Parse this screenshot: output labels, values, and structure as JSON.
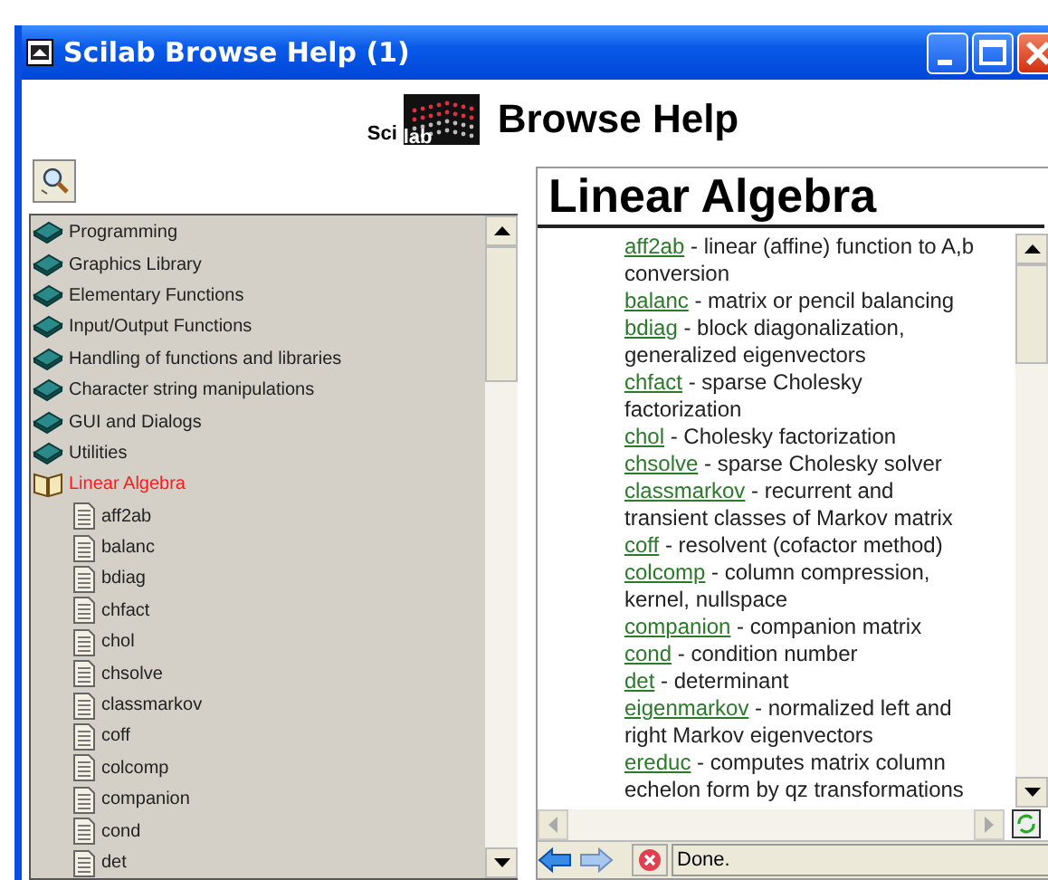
{
  "window": {
    "title": "Scilab Browse Help (1)"
  },
  "header": {
    "logo_text": "Sci",
    "logo_text2": "lab",
    "title": "Browse Help"
  },
  "tree": [
    {
      "label": "Programming",
      "expanded": false,
      "selected": false
    },
    {
      "label": "Graphics Library",
      "expanded": false,
      "selected": false
    },
    {
      "label": "Elementary Functions",
      "expanded": false,
      "selected": false
    },
    {
      "label": "Input/Output Functions",
      "expanded": false,
      "selected": false
    },
    {
      "label": "Handling of functions and libraries",
      "expanded": false,
      "selected": false
    },
    {
      "label": "Character string manipulations",
      "expanded": false,
      "selected": false
    },
    {
      "label": "GUI and Dialogs",
      "expanded": false,
      "selected": false
    },
    {
      "label": "Utilities",
      "expanded": false,
      "selected": false
    },
    {
      "label": "Linear Algebra",
      "expanded": true,
      "selected": true,
      "children": [
        {
          "label": "aff2ab",
          "selected": false
        },
        {
          "label": "balanc",
          "selected": false
        },
        {
          "label": "bdiag",
          "selected": false
        },
        {
          "label": "chfact",
          "selected": false
        },
        {
          "label": "chol",
          "selected": false
        },
        {
          "label": "chsolve",
          "selected": false
        },
        {
          "label": "classmarkov",
          "selected": false
        },
        {
          "label": "coff",
          "selected": false
        },
        {
          "label": "colcomp",
          "selected": false
        },
        {
          "label": "companion",
          "selected": false
        },
        {
          "label": "cond",
          "selected": false
        },
        {
          "label": "det",
          "selected": false
        }
      ]
    }
  ],
  "page": {
    "heading": "Linear Algebra",
    "entries": [
      {
        "name": "aff2ab",
        "description": " - linear (affine) function to A,b conversion"
      },
      {
        "name": "balanc",
        "description": " - matrix or pencil balancing"
      },
      {
        "name": "bdiag",
        "description": " - block diagonalization, generalized eigenvectors"
      },
      {
        "name": "chfact",
        "description": " - sparse Cholesky factorization"
      },
      {
        "name": "chol",
        "description": " - Cholesky factorization"
      },
      {
        "name": "chsolve",
        "description": " - sparse Cholesky solver"
      },
      {
        "name": "classmarkov",
        "description": " - recurrent and transient classes of Markov matrix"
      },
      {
        "name": "coff",
        "description": " - resolvent (cofactor method)"
      },
      {
        "name": "colcomp",
        "description": " - column compression, kernel, nullspace"
      },
      {
        "name": "companion",
        "description": " - companion matrix"
      },
      {
        "name": "cond",
        "description": " - condition number"
      },
      {
        "name": "det",
        "description": " - determinant"
      },
      {
        "name": "eigenmarkov",
        "description": " - normalized left and right Markov eigenvectors"
      },
      {
        "name": "ereduc",
        "description": " - computes matrix column echelon form by qz transformations"
      }
    ]
  },
  "status_bar": {
    "text": "Done."
  }
}
